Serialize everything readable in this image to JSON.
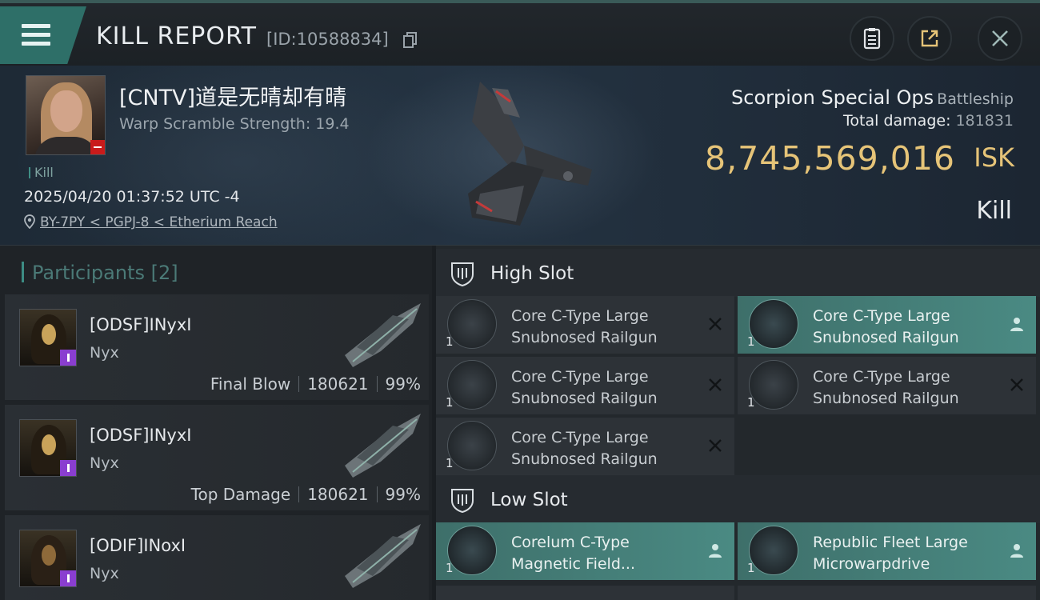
{
  "header": {
    "title": "KILL REPORT",
    "id_text": "[ID:10588834]"
  },
  "victim": {
    "name": "[CNTV]道是无晴却有晴",
    "warp_scramble": "Warp Scramble Strength: 19.4",
    "result_tag": "Kill",
    "datetime": "2025/04/20 01:37:52 UTC -4",
    "location": "BY-7PY < PGPJ-8 < Etherium Reach",
    "ship_name": "Scorpion Special Ops",
    "ship_class": "Battleship",
    "total_damage_label": "Total damage:",
    "total_damage": "181831",
    "isk_value": "8,745,569,016",
    "isk_unit": "ISK",
    "outcome": "Kill"
  },
  "participants": {
    "title": "Participants [2]",
    "items": [
      {
        "name": "[ODSF]INyxI",
        "ship": "Nyx",
        "role": "Final Blow",
        "damage": "180621",
        "percent": "99%"
      },
      {
        "name": "[ODSF]INyxI",
        "ship": "Nyx",
        "role": "Top Damage",
        "damage": "180621",
        "percent": "99%"
      },
      {
        "name": "[ODIF]INoxI",
        "ship": "Nyx",
        "role": "",
        "damage": "",
        "percent": ""
      }
    ]
  },
  "modules": {
    "high_slot_title": "High Slot",
    "low_slot_title": "Low Slot",
    "high": [
      {
        "qty": "1",
        "line1": "Core C-Type Large",
        "line2": "Snubnosed Railgun",
        "state": "destroyed"
      },
      {
        "qty": "1",
        "line1": "Core C-Type Large",
        "line2": "Snubnosed Railgun",
        "state": "dropped"
      },
      {
        "qty": "1",
        "line1": "Core C-Type Large",
        "line2": "Snubnosed Railgun",
        "state": "destroyed"
      },
      {
        "qty": "1",
        "line1": "Core C-Type Large",
        "line2": "Snubnosed Railgun",
        "state": "destroyed"
      },
      {
        "qty": "1",
        "line1": "Core C-Type Large",
        "line2": "Snubnosed Railgun",
        "state": "destroyed"
      }
    ],
    "low": [
      {
        "qty": "1",
        "line1": "Corelum C-Type",
        "line2": "Magnetic Field...",
        "state": "dropped"
      },
      {
        "qty": "1",
        "line1": "Republic Fleet Large",
        "line2": "Microwarpdrive",
        "state": "dropped"
      }
    ]
  },
  "colors": {
    "accent": "#2e6f68",
    "isk": "#e6c478",
    "fitted_row": "#4a8a83"
  },
  "icons": [
    "menu-icon",
    "clipboard-icon",
    "share-icon",
    "close-icon",
    "copy-icon",
    "location-pin-icon",
    "slot-icon",
    "user-icon",
    "x-icon"
  ]
}
